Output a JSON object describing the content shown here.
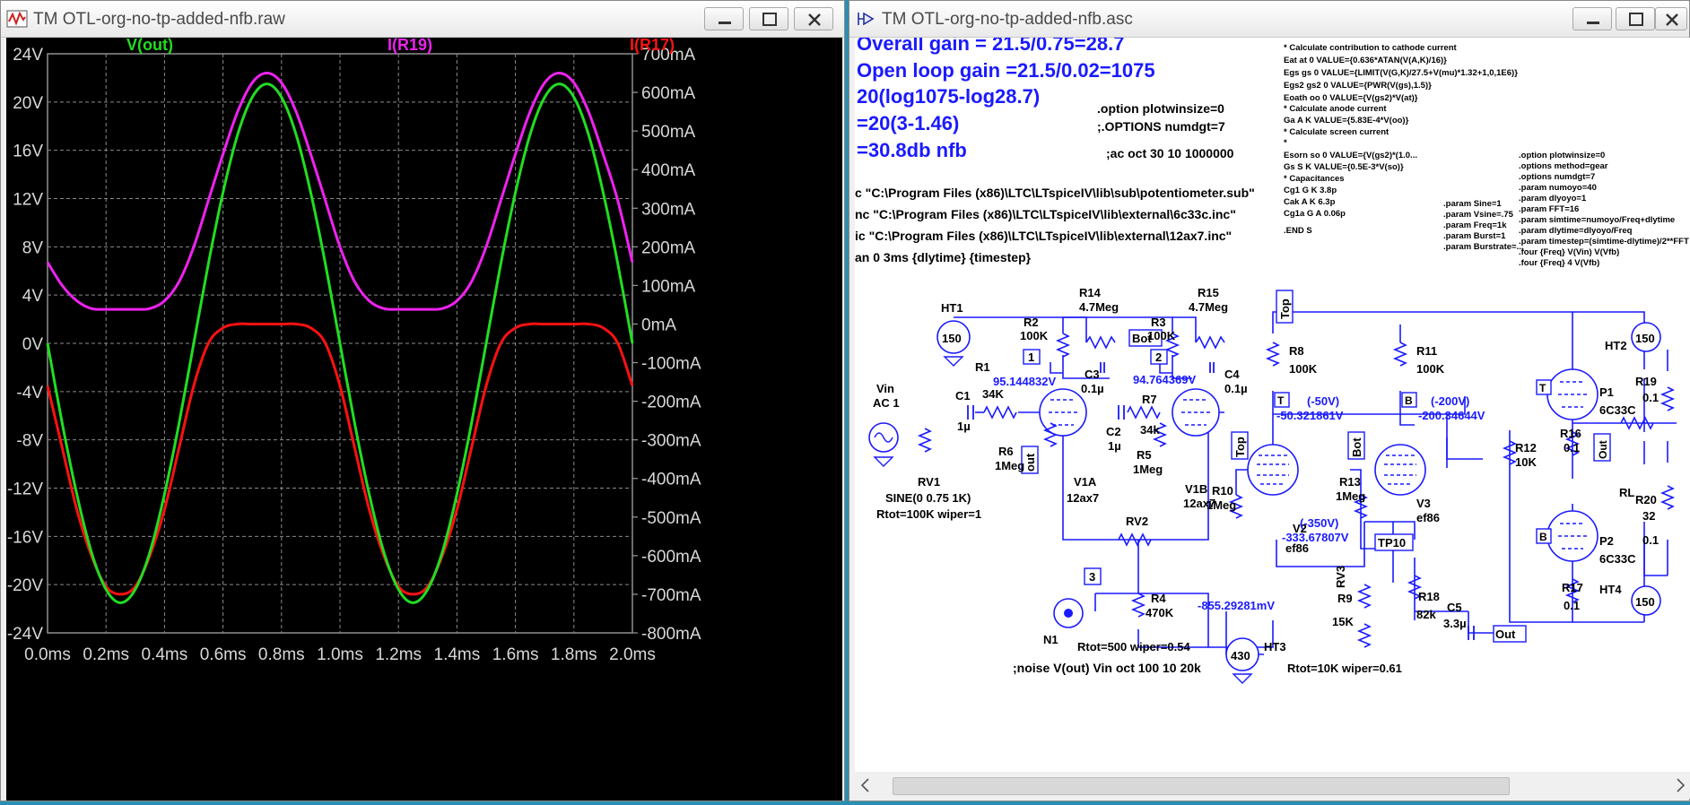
{
  "left_window": {
    "title": "TM OTL-org-no-tp-added-nfb.raw",
    "chart_data": {
      "type": "line",
      "x_tick_labels": [
        "0.0ms",
        "0.2ms",
        "0.4ms",
        "0.6ms",
        "0.8ms",
        "1.0ms",
        "1.2ms",
        "1.4ms",
        "1.6ms",
        "1.8ms",
        "2.0ms"
      ],
      "xlim": [
        0,
        2.0
      ],
      "left_axis": {
        "ylim": [
          -24,
          24
        ],
        "tick_labels": [
          "24V",
          "20V",
          "16V",
          "12V",
          "8V",
          "4V",
          "0V",
          "-4V",
          "-8V",
          "-12V",
          "-16V",
          "-20V",
          "-24V"
        ],
        "tick_values": [
          24,
          20,
          16,
          12,
          8,
          4,
          0,
          -4,
          -8,
          -12,
          -16,
          -20,
          -24
        ]
      },
      "right_axis": {
        "ylim": [
          -800,
          700
        ],
        "tick_labels": [
          "700mA",
          "600mA",
          "500mA",
          "400mA",
          "300mA",
          "200mA",
          "100mA",
          "0mA",
          "-100mA",
          "-200mA",
          "-300mA",
          "-400mA",
          "-500mA",
          "-600mA",
          "-700mA",
          "-800mA"
        ],
        "tick_values": [
          700,
          600,
          500,
          400,
          300,
          200,
          100,
          0,
          -100,
          -200,
          -300,
          -400,
          -500,
          -600,
          -700,
          -800
        ]
      },
      "grid": true,
      "series": [
        {
          "name": "V(out)",
          "axis": "left",
          "color": "#22dd22",
          "x": [
            0,
            0.05,
            0.1,
            0.15,
            0.2,
            0.25,
            0.3,
            0.35,
            0.4,
            0.45,
            0.5,
            0.55,
            0.6,
            0.65,
            0.7,
            0.75,
            0.8,
            0.85,
            0.9,
            0.95,
            1.0,
            1.05,
            1.1,
            1.15,
            1.2,
            1.25,
            1.3,
            1.35,
            1.4,
            1.45,
            1.5,
            1.55,
            1.6,
            1.65,
            1.7,
            1.75,
            1.8,
            1.85,
            1.9,
            1.95,
            2.0
          ],
          "values": [
            0,
            -6.6,
            -12.5,
            -17.3,
            -20.4,
            -21.5,
            -20.4,
            -17.3,
            -12.5,
            -6.6,
            0,
            6.6,
            12.5,
            17.3,
            20.4,
            21.5,
            20.4,
            17.3,
            12.5,
            6.6,
            0,
            -6.6,
            -12.5,
            -17.3,
            -20.4,
            -21.5,
            -20.4,
            -17.3,
            -12.5,
            -6.6,
            0,
            6.6,
            12.5,
            17.3,
            20.4,
            21.5,
            20.4,
            17.3,
            12.5,
            6.6,
            0
          ]
        },
        {
          "name": "I(R19)",
          "axis": "right",
          "color": "#ee22ee",
          "x": [
            0,
            0.05,
            0.1,
            0.15,
            0.2,
            0.25,
            0.3,
            0.35,
            0.4,
            0.45,
            0.5,
            0.55,
            0.6,
            0.65,
            0.7,
            0.75,
            0.8,
            0.85,
            0.9,
            0.95,
            1.0,
            1.05,
            1.1,
            1.15,
            1.2,
            1.25,
            1.3,
            1.35,
            1.4,
            1.45,
            1.5,
            1.55,
            1.6,
            1.65,
            1.7,
            1.75,
            1.8,
            1.85,
            1.9,
            1.95,
            2.0
          ],
          "values": [
            160,
            100,
            60,
            40,
            38,
            38,
            38,
            40,
            60,
            110,
            200,
            320,
            440,
            550,
            625,
            650,
            625,
            550,
            440,
            320,
            200,
            110,
            60,
            40,
            38,
            38,
            38,
            40,
            60,
            110,
            200,
            320,
            440,
            550,
            625,
            650,
            625,
            550,
            440,
            320,
            160
          ]
        },
        {
          "name": "I(R17)",
          "axis": "right",
          "color": "#ff1111",
          "x": [
            0,
            0.05,
            0.1,
            0.15,
            0.2,
            0.25,
            0.3,
            0.35,
            0.4,
            0.45,
            0.5,
            0.55,
            0.6,
            0.65,
            0.7,
            0.75,
            0.8,
            0.85,
            0.9,
            0.95,
            1.0,
            1.05,
            1.1,
            1.15,
            1.2,
            1.25,
            1.3,
            1.35,
            1.4,
            1.45,
            1.5,
            1.55,
            1.6,
            1.65,
            1.7,
            1.75,
            1.8,
            1.85,
            1.9,
            1.95,
            2.0
          ],
          "values": [
            -160,
            -320,
            -480,
            -600,
            -680,
            -700,
            -680,
            -600,
            -480,
            -320,
            -160,
            -50,
            -10,
            0,
            0,
            0,
            0,
            0,
            -10,
            -50,
            -160,
            -320,
            -480,
            -600,
            -680,
            -700,
            -680,
            -600,
            -480,
            -320,
            -160,
            -50,
            -10,
            0,
            0,
            0,
            0,
            0,
            -10,
            -50,
            -160
          ]
        }
      ]
    }
  },
  "right_window": {
    "title": "TM OTL-org-no-tp-added-nfb.asc",
    "notes": {
      "gain1": "Overall gain = 21.5/0.75=28.7",
      "gain2": "Open loop gain =21.5/0.02=1075",
      "calc1": "20(log1075-log28.7)",
      "calc2": "=20(3-1.46)",
      "calc3": "=30.8db nfb"
    },
    "directives": {
      "opt1": ".option plotwinsize=0",
      "opt2": ";.OPTIONS numdgt=7",
      "ac": ";ac oct 30 10 1000000",
      "inc1": "c \"C:\\Program Files (x86)\\LTC\\LTspiceIV\\lib\\sub\\potentiometer.sub\"",
      "inc2": "nc \"C:\\Program Files (x86)\\LTC\\LTspiceIV\\lib\\external\\6c33c.inc\"",
      "inc3": "ic \"C:\\Program Files (x86)\\LTC\\LTspiceIV\\lib\\external\\12ax7.inc\"",
      "tran": "an 0 3ms {dlytime} {timestep}",
      "noise": ";noise V(out) Vin oct 100 10 20k"
    },
    "model_text": [
      "* Calculate contribution to cathode current",
      "Eat       at        0         VALUE={0.636*ATAN(V(A,K)/16)}",
      "Egs       gs        0         VALUE={LIMIT(V(G,K)/27.5+V(mu)*1.32+1,0,1E6)}",
      "Egs2      gs2       0         VALUE={PWR(V(gs),1.5)}",
      "Eoath     oo        0         VALUE={V(gs2)*V(at)}",
      "* Calculate anode current",
      "Ga        A         K         VALUE={5.83E-4*V(oo)}",
      "* Calculate screen current",
      "*",
      "Esorn     so        0         VALUE={V(gs2)*(1.0...",
      "Gs        S         K         VALUE={0.5E-3*V(so)}",
      "* Capacitances",
      "Cg1       G         K         3.8p",
      "Cak       A         K         6.3p",
      "Cg1a      G         A         0.06p",
      ".END S"
    ],
    "params_text": [
      ".option plotwinsize=0",
      ".options method=gear",
      ".options numdgt=7",
      ".param numoyo=40",
      ".param dlyoyo=1",
      ".param FFT=16",
      ".param simtime=numoyo/Freq+dlytime",
      ".param dlytime=dlyoyo/Freq",
      ".param timestep=(simtime-dlytime)/2**FFT",
      ".four {Freq} V(Vin) V(Vfb)",
      ".four {Freq} 4 V(Vfb)"
    ],
    "sine_params": [
      ".param Sine=1",
      ".param Vsine=.75",
      ".param Freq=1k",
      ".param Burst=1",
      ".param Burstrate=..."
    ],
    "labels": {
      "HT1": "HT1",
      "ht1v": "150",
      "R14": "R14",
      "R14v": "4.7Meg",
      "R15": "R15",
      "R15v": "4.7Meg",
      "R2": "R2",
      "R2v": "100K",
      "R3": "R3",
      "R3v": "100K",
      "R1": "R1",
      "R1v": "34K",
      "C1": "C1",
      "C1v": "1µ",
      "C3": "C3",
      "C3v": "0.1µ",
      "C4": "C4",
      "C4v": "0.1µ",
      "C2": "C2",
      "C2v": "1µ",
      "R7": "R7",
      "R7v": "34k",
      "R5": "R5",
      "R5v": "1Meg",
      "R6": "R6",
      "R6v": "1Meg",
      "v1": "95.144832V",
      "v2": "94.764369V",
      "Vin": "Vin",
      "ac1": "AC 1",
      "RV1": "RV1",
      "sine": "SINE(0 0.75 1K)",
      "rtot1": "Rtot=100K wiper=1",
      "V1A": "V1A",
      "V1Am": "12ax7",
      "V1B": "V1B",
      "V1Bm": "12ax7",
      "RV2": "RV2",
      "R4": "R4",
      "R4v": "470K",
      "v855": "-855.29281mV",
      "N1": "N1",
      "rtot2": "Rtot=500 wiper=0.54",
      "HT3": "HT3",
      "ht3v": "430",
      "R8": "R8",
      "R8v": "100K",
      "m50": "(-50V)",
      "v50": "-50.321861V",
      "R10": "R10",
      "R10v": "1Meg",
      "V2": "V2",
      "V2m": "ef86",
      "m350": "(-350V)",
      "v333": "-333.67807V",
      "RV3": "RV3",
      "R9": "R9",
      "R9v": "15K",
      "rtot3": "Rtot=10K wiper=0.61",
      "R11": "R11",
      "R11v": "100K",
      "m200": "(-200V)",
      "v200": "-200.34644V",
      "R13": "R13",
      "R13v": "1Meg",
      "V3": "V3",
      "V3m": "ef86",
      "TP10": "TP10",
      "R18": "R18",
      "R18v": "82k",
      "C5": "C5",
      "C5v": "3.3µ",
      "Out": "Out",
      "R12": "R12",
      "R12v": "10K",
      "R16": "R16",
      "R16v": "0.1",
      "HT2": "HT2",
      "ht2v": "150",
      "R19": "R19",
      "R19v": "0.1",
      "P1": "P1",
      "P1m": "6C33C",
      "RL": "RL",
      "RLv": "32",
      "R20": "R20",
      "R20v": "0.1",
      "P2": "P2",
      "P2m": "6C33C",
      "R17": "R17",
      "R17v": "0.1",
      "HT4": "HT4",
      "ht4v": "150",
      "Top": "Top",
      "Bot": "Bot",
      "T": "T",
      "B": "B",
      "n1": "1",
      "n2": "2",
      "n3": "3",
      "out": "out"
    }
  }
}
